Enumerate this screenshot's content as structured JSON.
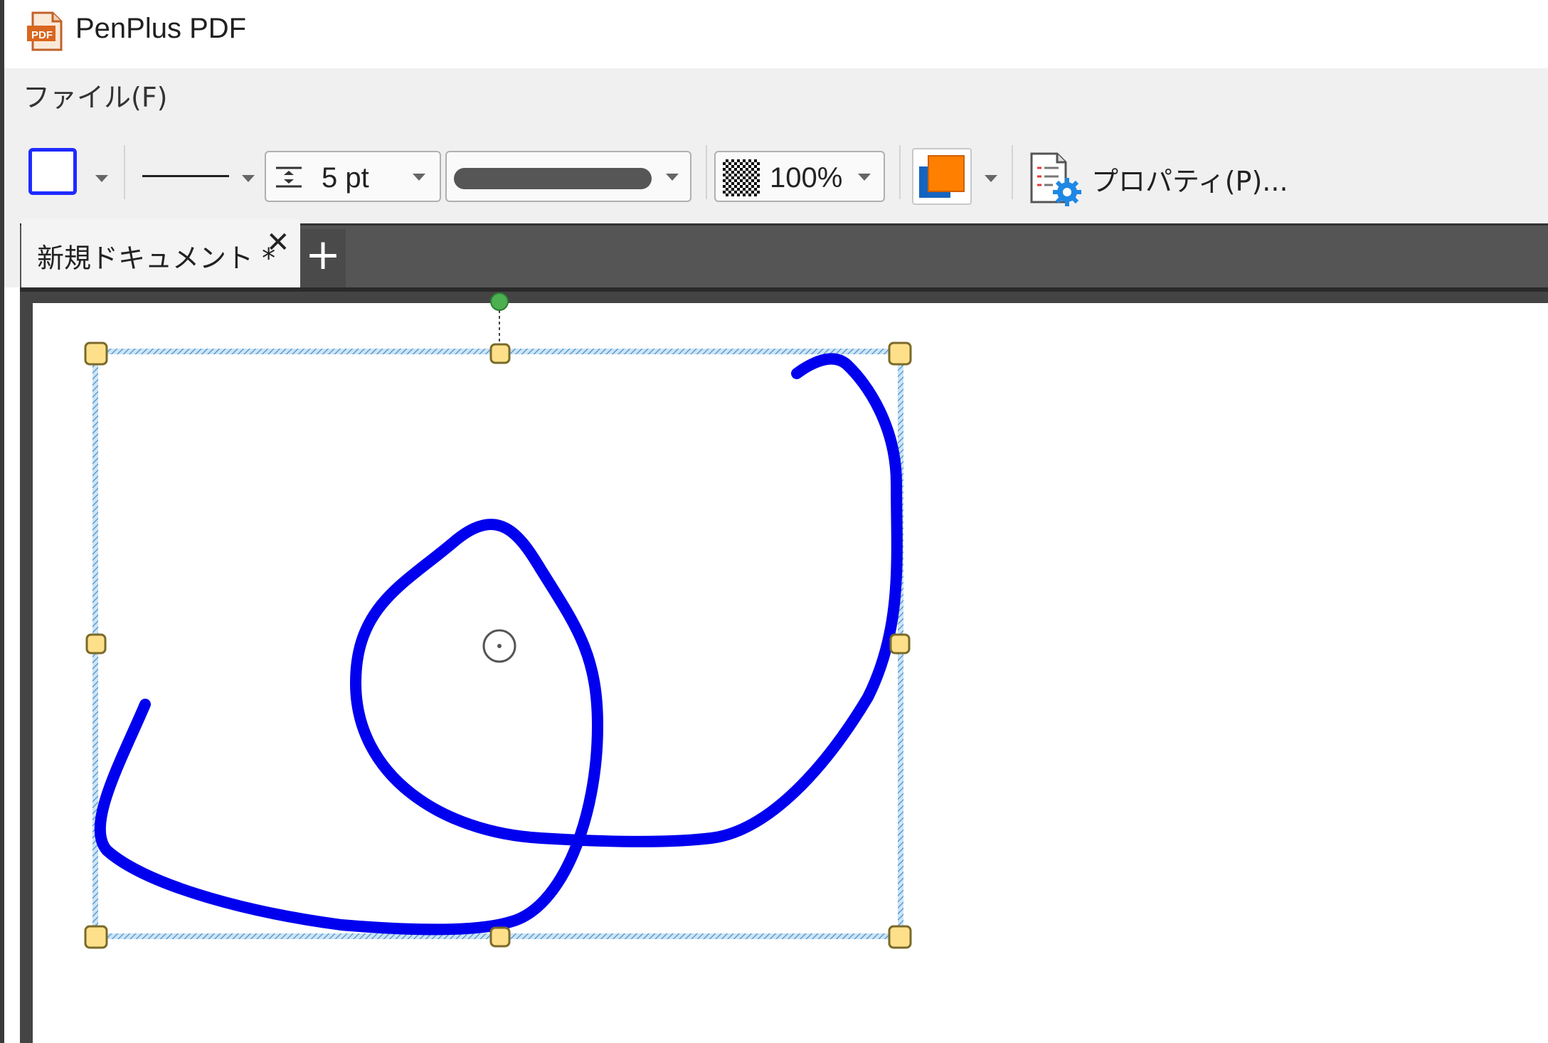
{
  "window": {
    "title": "PenPlus PDF",
    "app_icon_label": "PDF"
  },
  "menubar": {
    "file": "ファイル(F)"
  },
  "toolbar": {
    "shape_color": "#1e2bff",
    "line_width": "5 pt",
    "opacity": "100%",
    "fill_color": "#ff7f00",
    "secondary_color": "#1565c0",
    "properties_label": "プロパティ(P)..."
  },
  "tabs": [
    {
      "label": "新規ドキュメント *",
      "close": "✕",
      "active": true
    }
  ],
  "tab_add": "+",
  "drawing": {
    "stroke_color": "#0000ee",
    "selection_color": "#5a9fd4",
    "handle_color": "#ffe08a",
    "rotate_handle_color": "#4caf50"
  }
}
